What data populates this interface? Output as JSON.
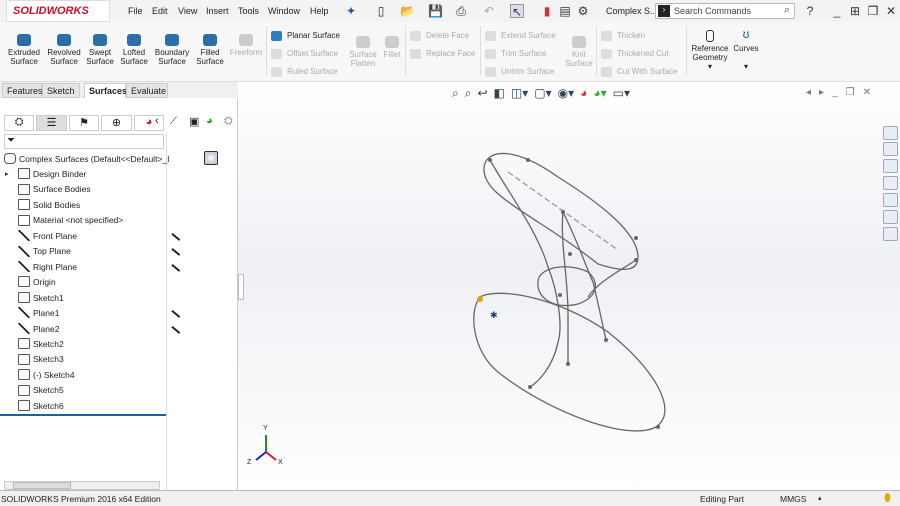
{
  "app": {
    "logo": "SOLIDWORKS",
    "doc_title": "Complex S...",
    "search_placeholder": "Search Commands"
  },
  "menu": [
    "File",
    "Edit",
    "View",
    "Insert",
    "Tools",
    "Window",
    "Help"
  ],
  "ribbon": {
    "large": [
      {
        "label": "Extruded Surface"
      },
      {
        "label": "Revolved Surface"
      },
      {
        "label": "Swept Surface"
      },
      {
        "label": "Lofted Surface"
      },
      {
        "label": "Boundary Surface"
      },
      {
        "label": "Filled Surface"
      },
      {
        "label": "Freeform"
      }
    ],
    "col1": [
      "Planar Surface",
      "Offset Surface",
      "Ruled Surface"
    ],
    "mid": [
      {
        "label": "Surface Flatten"
      },
      {
        "label": "Fillet"
      }
    ],
    "col2": [
      "Delete Face",
      "Replace Face"
    ],
    "col3": [
      "Extend Surface",
      "Trim Surface",
      "Untrim Surface"
    ],
    "knit": "Knit Surface",
    "col4": [
      "Thicken",
      "Thickened Cut",
      "Cut With Surface"
    ],
    "ref": "Reference Geometry",
    "curves": "Curves"
  },
  "tabs": [
    "Features",
    "Sketch",
    "Surfaces",
    "Evaluate"
  ],
  "active_tab": "Surfaces",
  "tree": {
    "root": "Complex Surfaces  (Default<<Default>_I",
    "items": [
      "Design Binder",
      "Surface Bodies",
      "Solid Bodies",
      "Material <not specified>",
      "Front Plane",
      "Top Plane",
      "Right Plane",
      "Origin",
      "Sketch1",
      "Plane1",
      "Plane2",
      "Sketch2",
      "Sketch3",
      "(-) Sketch4",
      "Sketch5",
      "Sketch6"
    ]
  },
  "triad": {
    "x": "X",
    "y": "Y",
    "z": "Z"
  },
  "status": {
    "edition": "SOLIDWORKS Premium 2016 x64 Edition",
    "mode": "Editing Part",
    "units": "MMGS"
  }
}
